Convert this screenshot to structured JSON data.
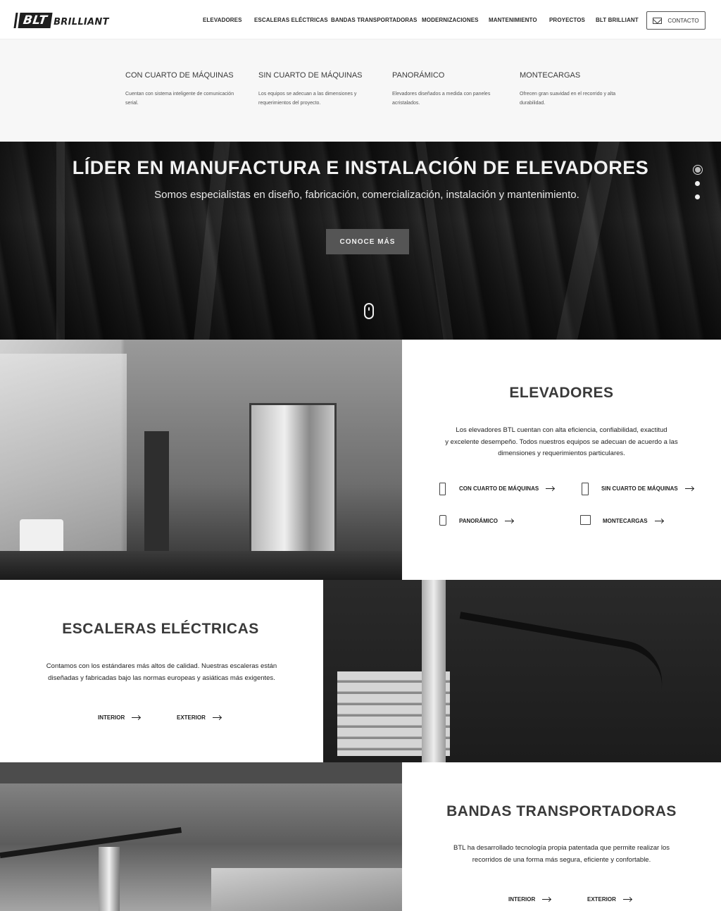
{
  "header": {
    "logo_box": "BLT",
    "logo_word": "BRILLIANT",
    "nav": [
      "ELEVADORES",
      "ESCALERAS ELÉCTRICAS",
      "BANDAS TRANSPORTADORAS",
      "MODERNIZACIONES",
      "MANTENIMIENTO",
      "PROYECTOS",
      "BLT BRILLIANT"
    ],
    "contact_label": "CONTACTO"
  },
  "submenu": [
    {
      "title": "CON CUARTO DE MÁQUINAS",
      "desc": "Cuentan con sistema inteligente de comunicación serial."
    },
    {
      "title": "SIN CUARTO DE MÁQUINAS",
      "desc": "Los equipos se adecuan a las dimensiones y requerimientos del proyecto."
    },
    {
      "title": "PANORÁMICO",
      "desc": "Elevadores diseñados a medida con paneles acristalados."
    },
    {
      "title": "MONTECARGAS",
      "desc": "Ofrecen gran suavidad en el recorrido y alta durabilidad."
    }
  ],
  "hero": {
    "title": "LÍDER EN MANUFACTURA E INSTALACIÓN DE ELEVADORES",
    "subtitle": "Somos especialistas en diseño, fabricación, comercialización, instalación y mantenimiento.",
    "button": "CONOCE MÁS"
  },
  "elevadores": {
    "title": "ELEVADORES",
    "desc_lines": [
      "Los elevadores BTL cuentan con  alta eficiencia, confiabilidad, exactitud",
      "y excelente desempeño. Todos nuestros equipos se adecuan de acuerdo a las",
      "dimensiones y requerimientos particulares."
    ],
    "links": [
      "CON CUARTO DE MÁQUINAS",
      "SIN CUARTO DE MÁQUINAS",
      "PANORÁMICO",
      "MONTECARGAS"
    ]
  },
  "escaleras": {
    "title": "ESCALERAS ELÉCTRICAS",
    "desc_lines": [
      "Contamos con los estándares más altos de calidad. Nuestras escaleras están",
      "diseñadas y fabricadas bajo las normas europeas y asiáticas más exigentes."
    ],
    "links": [
      "INTERIOR",
      "EXTERIOR"
    ]
  },
  "bandas": {
    "title": "BANDAS TRANSPORTADORAS",
    "desc_lines": [
      "BTL ha desarrollado tecnología propia patentada que permite realizar los",
      "recorridos de una forma más segura, eficiente y confortable."
    ],
    "links": [
      "INTERIOR",
      "EXTERIOR"
    ]
  }
}
